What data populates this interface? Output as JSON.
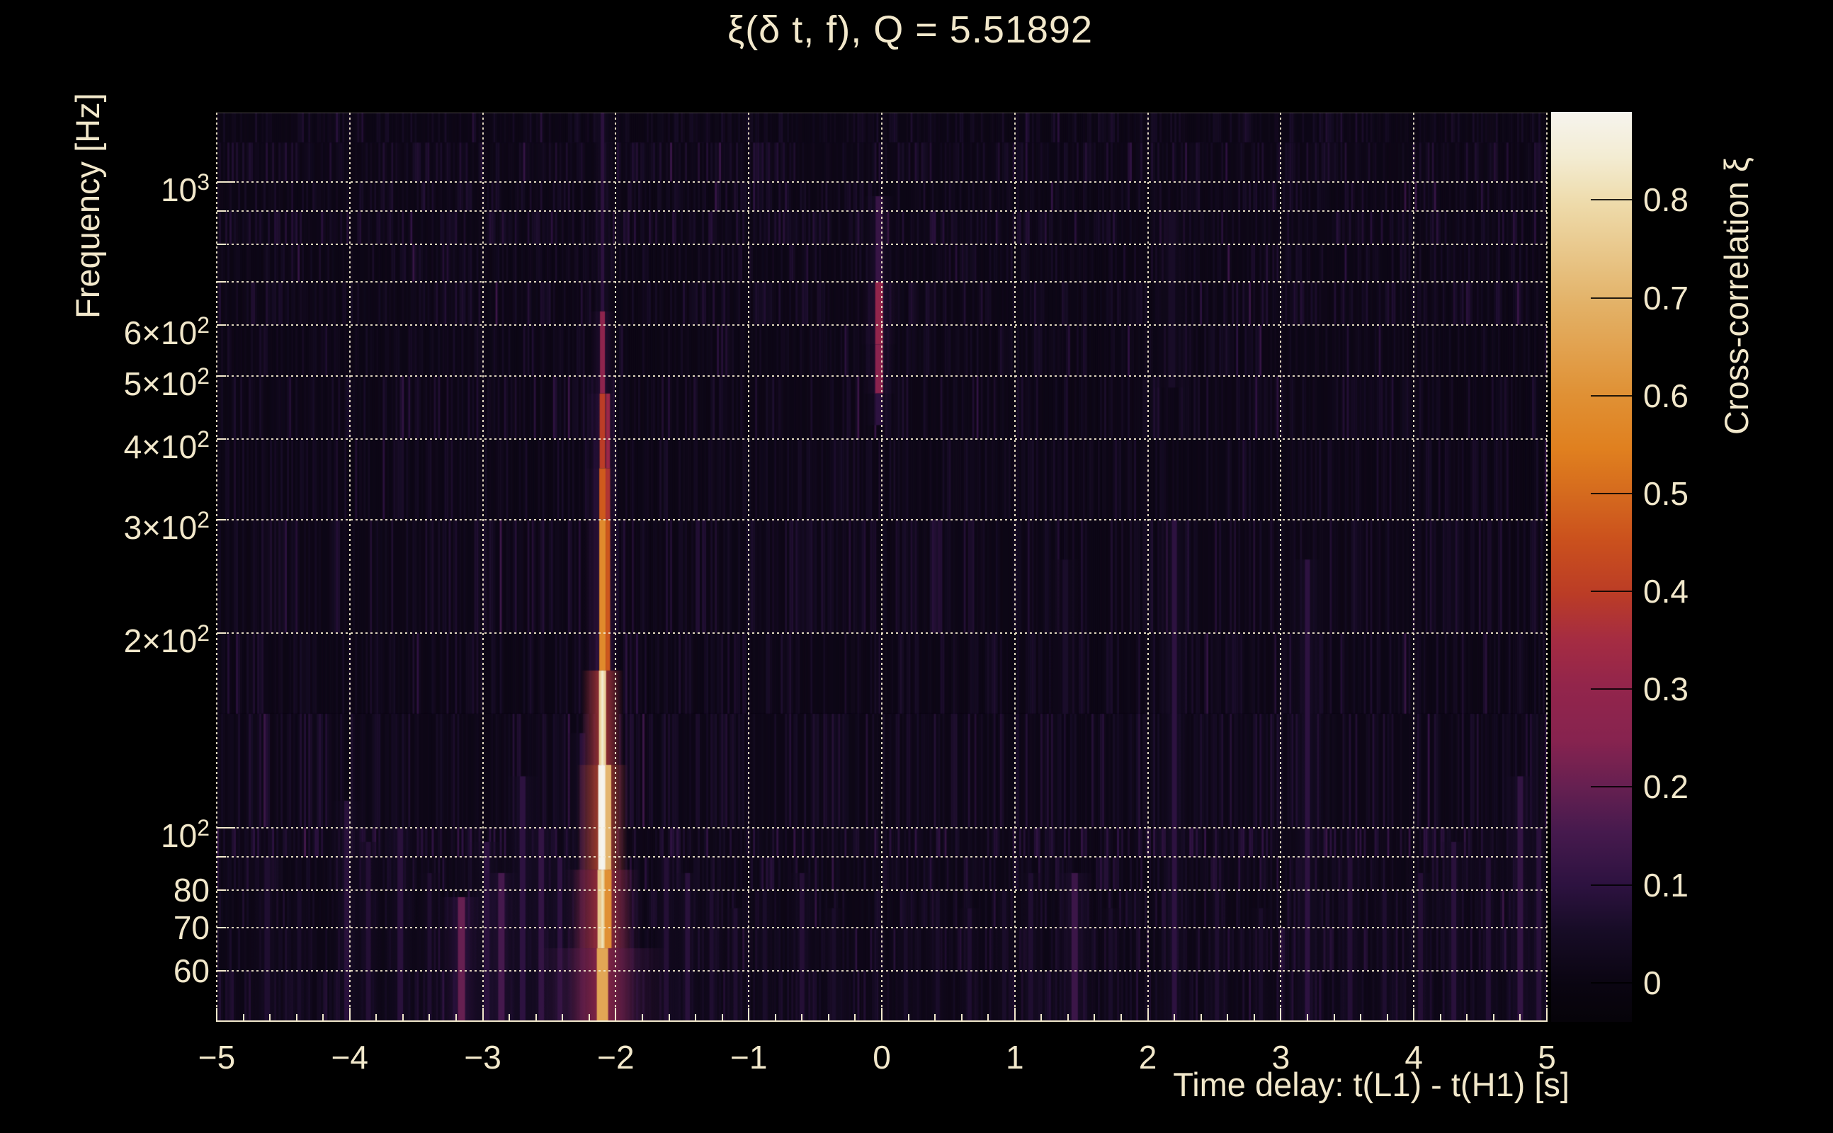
{
  "page": {
    "background": "#000000",
    "text_color": "#f2e8cb",
    "grid_color": "#f3e9cd"
  },
  "chart_data": {
    "type": "heatmap",
    "title": "ξ(δ t, f), Q = 5.51892",
    "xlabel": "Time delay: t(L1) - t(H1) [s]",
    "ylabel": "Frequency [Hz]",
    "colorbar_title": "Cross-correlation ξ",
    "x_range_s": [
      -5,
      5
    ],
    "x_major_tick_step": 1,
    "x_minor_tick_step": 0.2,
    "y_range_hz": [
      50,
      1280
    ],
    "y_scale": "log",
    "grid": true,
    "x_ticks": [
      {
        "t": -5,
        "label": "−5"
      },
      {
        "t": -4,
        "label": "−4"
      },
      {
        "t": -3,
        "label": "−3"
      },
      {
        "t": -2,
        "label": "−2"
      },
      {
        "t": -1,
        "label": "−1"
      },
      {
        "t": 0,
        "label": "0"
      },
      {
        "t": 1,
        "label": "1"
      },
      {
        "t": 2,
        "label": "2"
      },
      {
        "t": 3,
        "label": "3"
      },
      {
        "t": 4,
        "label": "4"
      },
      {
        "t": 5,
        "label": "5"
      }
    ],
    "y_ticks": [
      {
        "f": 1000,
        "base": "10",
        "sup": "3"
      },
      {
        "f": 600,
        "base": "6×10",
        "sup": "2"
      },
      {
        "f": 500,
        "base": "5×10",
        "sup": "2"
      },
      {
        "f": 400,
        "base": "4×10",
        "sup": "2"
      },
      {
        "f": 300,
        "base": "3×10",
        "sup": "2"
      },
      {
        "f": 200,
        "base": "2×10",
        "sup": "2"
      },
      {
        "f": 100,
        "base": "10",
        "sup": "2"
      },
      {
        "f": 80,
        "base": "80",
        "sup": ""
      },
      {
        "f": 70,
        "base": "70",
        "sup": ""
      },
      {
        "f": 60,
        "base": "60",
        "sup": ""
      }
    ],
    "y_gridline_freqs_hz": [
      1000,
      900,
      800,
      700,
      600,
      500,
      400,
      300,
      200,
      100,
      90,
      80,
      70,
      60
    ],
    "colorbar": {
      "range": [
        -0.04,
        0.89
      ],
      "ticks": [
        {
          "v": 0.8,
          "label": "0.8"
        },
        {
          "v": 0.7,
          "label": "0.7"
        },
        {
          "v": 0.6,
          "label": "0.6"
        },
        {
          "v": 0.5,
          "label": "0.5"
        },
        {
          "v": 0.4,
          "label": "0.4"
        },
        {
          "v": 0.3,
          "label": "0.3"
        },
        {
          "v": 0.2,
          "label": "0.2"
        },
        {
          "v": 0.1,
          "label": "0.1"
        },
        {
          "v": 0,
          "label": "0"
        }
      ]
    },
    "palette_stops": [
      [
        0.0,
        "#060309"
      ],
      [
        0.04,
        "#0a0511"
      ],
      [
        0.1,
        "#170c26"
      ],
      [
        0.15,
        "#2d1240"
      ],
      [
        0.21,
        "#471a4e"
      ],
      [
        0.26,
        "#672051"
      ],
      [
        0.31,
        "#87234f"
      ],
      [
        0.37,
        "#93254b"
      ],
      [
        0.42,
        "#a52c42"
      ],
      [
        0.47,
        "#bb3c26"
      ],
      [
        0.53,
        "#cb511d"
      ],
      [
        0.58,
        "#d56a1e"
      ],
      [
        0.63,
        "#e0801f"
      ],
      [
        0.69,
        "#e09135"
      ],
      [
        0.79,
        "#e3b268"
      ],
      [
        0.9,
        "#eedbab"
      ],
      [
        0.95,
        "#f3ecd2"
      ],
      [
        1.0,
        "#f6f4ee"
      ]
    ],
    "features": {
      "main_stripe": {
        "t_s": -2.1,
        "segments": [
          {
            "f_hz": [
              1280,
              630
            ],
            "xi": 0.095,
            "core_w": 5,
            "halo_w": 14,
            "halo_xi": 0.05
          },
          {
            "f_hz": [
              630,
              470
            ],
            "xi": 0.28,
            "core_w": 7,
            "halo_w": 18,
            "halo_xi": 0.08
          },
          {
            "f_hz": [
              470,
              360
            ],
            "xi": 0.4,
            "core_w": 8,
            "halo_w": 22,
            "halo_xi": 0.1,
            "dx2": 9
          },
          {
            "f_hz": [
              360,
              300
            ],
            "xi": 0.47,
            "core_w": 9,
            "halo_w": 24,
            "halo_xi": 0.11,
            "dx2": 9
          },
          {
            "f_hz": [
              300,
              175
            ],
            "xi": 0.58,
            "core_w": 9,
            "halo_w": 26,
            "halo_xi": 0.12,
            "dx2": 9
          },
          {
            "f_hz": [
              175,
              125
            ],
            "xi": 0.78,
            "core_w": 10,
            "halo_w": 28,
            "halo_xi": 0.14
          },
          {
            "f_hz": [
              125,
              86
            ],
            "xi": 0.88,
            "core_w": 12,
            "halo_w": 34,
            "halo_xi": 0.16,
            "dx2": 10
          },
          {
            "f_hz": [
              86,
              65
            ],
            "xi": 0.75,
            "core_w": 14,
            "halo_w": 54,
            "halo_xi": 0.18,
            "dx2": 10
          },
          {
            "f_hz": [
              65,
              50
            ],
            "xi": 0.66,
            "core_w": 16,
            "halo_w": 92,
            "halo_xi": 0.16
          }
        ]
      },
      "zero_lag_stripe": {
        "t_s": -0.02,
        "segments": [
          {
            "f_hz": [
              950,
              700
            ],
            "xi": 0.12,
            "core_w": 10,
            "halo_w": 22,
            "halo_xi": 0.06
          },
          {
            "f_hz": [
              700,
              560
            ],
            "xi": 0.3,
            "core_w": 11,
            "halo_w": 26,
            "halo_xi": 0.08
          },
          {
            "f_hz": [
              560,
              470
            ],
            "xi": 0.26,
            "core_w": 11,
            "halo_w": 24,
            "halo_xi": 0.07
          },
          {
            "f_hz": [
              470,
              420
            ],
            "xi": 0.1,
            "core_w": 10,
            "halo_w": 20,
            "halo_xi": 0.05
          }
        ]
      },
      "minor_streaks": [
        [
          -4.62,
          90,
          50,
          0.07,
          8
        ],
        [
          -4.38,
          80,
          50,
          0.06,
          6
        ],
        [
          -4.02,
          110,
          50,
          0.09,
          8
        ],
        [
          -3.86,
          95,
          50,
          0.08,
          7
        ],
        [
          -3.62,
          100,
          50,
          0.09,
          8
        ],
        [
          -3.4,
          85,
          50,
          0.07,
          6
        ],
        [
          -3.16,
          78,
          50,
          0.2,
          10
        ],
        [
          -2.97,
          95,
          50,
          0.1,
          8
        ],
        [
          -2.86,
          85,
          50,
          0.15,
          9
        ],
        [
          -2.7,
          120,
          50,
          0.1,
          8
        ],
        [
          -2.56,
          100,
          50,
          0.11,
          8
        ],
        [
          -2.42,
          90,
          50,
          0.1,
          7
        ],
        [
          -2.25,
          140,
          50,
          0.09,
          8
        ],
        [
          -1.95,
          80,
          50,
          0.06,
          6
        ],
        [
          -1.62,
          90,
          50,
          0.08,
          7
        ],
        [
          -1.46,
          85,
          50,
          0.09,
          7
        ],
        [
          -1.28,
          80,
          50,
          0.07,
          6
        ],
        [
          -1.1,
          75,
          50,
          0.07,
          6
        ],
        [
          -0.88,
          80,
          50,
          0.06,
          6
        ],
        [
          -0.6,
          85,
          50,
          0.08,
          7
        ],
        [
          -0.36,
          75,
          50,
          0.06,
          6
        ],
        [
          0.18,
          70,
          50,
          0.06,
          6
        ],
        [
          0.42,
          80,
          50,
          0.06,
          6
        ],
        [
          0.66,
          75,
          50,
          0.07,
          6
        ],
        [
          0.92,
          80,
          50,
          0.06,
          6
        ],
        [
          1.12,
          85,
          50,
          0.07,
          7
        ],
        [
          1.38,
          260,
          150,
          0.06,
          8
        ],
        [
          1.45,
          85,
          50,
          0.13,
          9
        ],
        [
          1.72,
          75,
          50,
          0.06,
          6
        ],
        [
          2.18,
          900,
          480,
          0.055,
          10
        ],
        [
          2.2,
          300,
          50,
          0.1,
          7
        ],
        [
          2.52,
          80,
          50,
          0.07,
          6
        ],
        [
          2.85,
          75,
          50,
          0.06,
          6
        ],
        [
          3.2,
          260,
          50,
          0.1,
          7
        ],
        [
          3.52,
          90,
          50,
          0.08,
          7
        ],
        [
          3.78,
          80,
          50,
          0.07,
          6
        ],
        [
          4.05,
          85,
          50,
          0.08,
          7
        ],
        [
          4.3,
          95,
          50,
          0.09,
          7
        ],
        [
          4.56,
          90,
          50,
          0.08,
          7
        ],
        [
          4.8,
          120,
          50,
          0.11,
          8
        ],
        [
          4.94,
          100,
          50,
          0.09,
          7
        ]
      ]
    },
    "bands": {
      "edges_hz": [
        1280,
        1150,
        1000,
        900,
        800,
        700,
        600,
        500,
        400,
        300,
        200,
        150,
        100,
        90,
        80,
        70,
        60,
        50
      ],
      "base_xi": [
        0.022,
        0.03,
        0.025,
        0.033,
        0.024,
        0.029,
        0.022,
        0.027,
        0.024,
        0.03,
        0.026,
        0.031,
        0.042,
        0.034,
        0.028,
        0.036,
        0.031
      ]
    },
    "texture": {
      "seed": 13,
      "col_step_s": 0.016,
      "bright_col_prob": 0.035
    }
  }
}
